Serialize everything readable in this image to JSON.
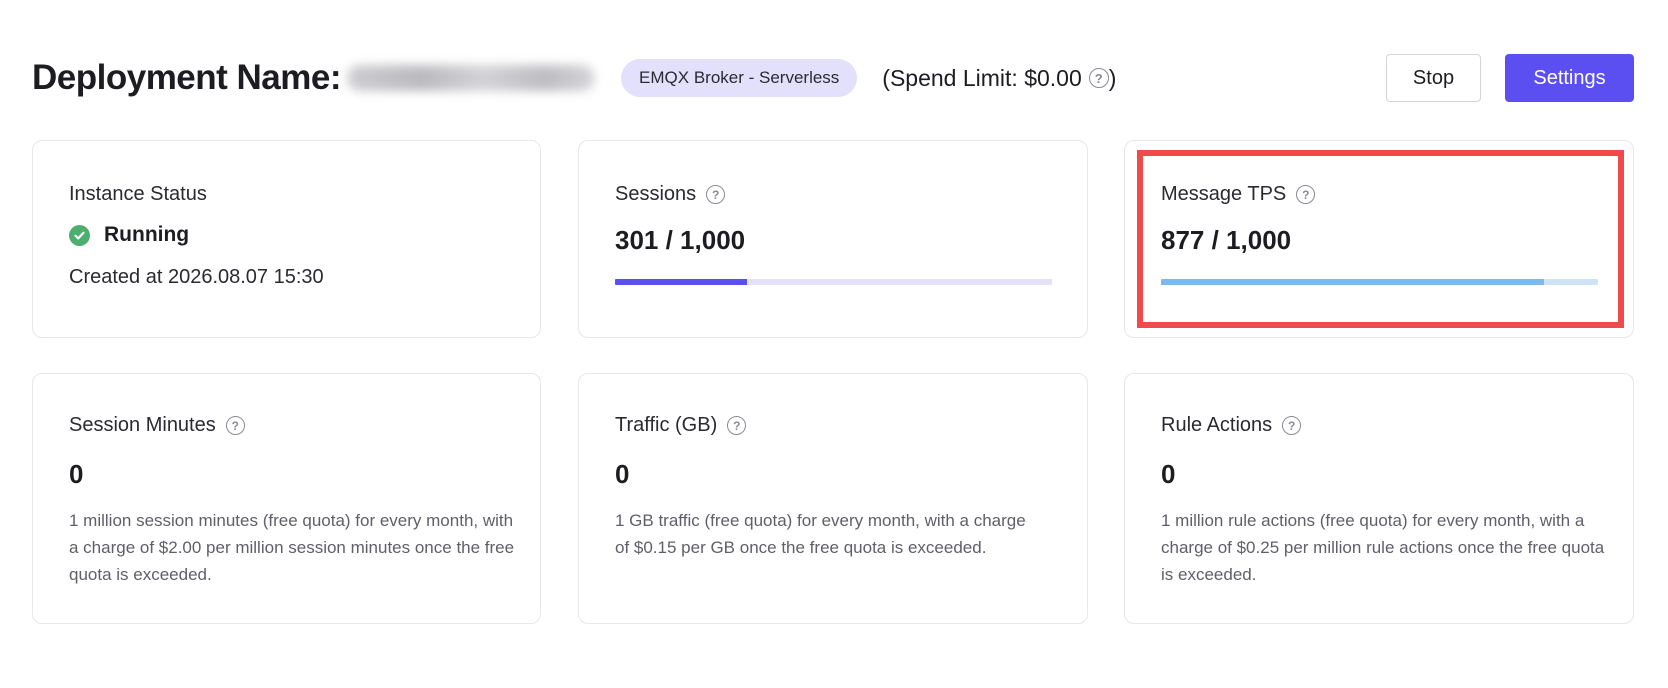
{
  "header": {
    "title": "Deployment Name:",
    "plan_badge": "EMQX Broker - Serverless",
    "spend_limit": "(Spend Limit: $0.00",
    "spend_close": ")",
    "stop_label": "Stop",
    "settings_label": "Settings"
  },
  "cards": {
    "instance_status": {
      "label": "Instance Status",
      "status": "Running",
      "created": "Created at 2026.08.07 15:30"
    },
    "sessions": {
      "label": "Sessions",
      "value": "301 / 1,000",
      "used": 301,
      "limit": 1000
    },
    "message_tps": {
      "label": "Message TPS",
      "value": "877 / 1,000",
      "used": 877,
      "limit": 1000
    },
    "session_minutes": {
      "label": "Session Minutes",
      "value": "0",
      "desc": "1 million session minutes (free quota) for every month, with a charge of $2.00 per million session minutes once the free quota is exceeded."
    },
    "traffic": {
      "label": "Traffic (GB)",
      "value": "0",
      "desc": "1 GB traffic (free quota) for every month, with a charge of $0.15 per GB once the free quota is exceeded."
    },
    "rule_actions": {
      "label": "Rule Actions",
      "value": "0",
      "desc": "1 million rule actions (free quota) for every month, with a charge of $0.25 per million rule actions once the free quota is exceeded."
    }
  },
  "icons": {
    "help": "?"
  },
  "colors": {
    "primary": "#5b4ff2",
    "badge_bg": "#e3e0fb",
    "sessions_fill": "#5b4ff2",
    "sessions_track": "#e3e0f8",
    "tps_fill": "#7fb8ee",
    "tps_track": "#cfe3f7",
    "running": "#4caf6e",
    "highlight": "#ef4b4b"
  }
}
